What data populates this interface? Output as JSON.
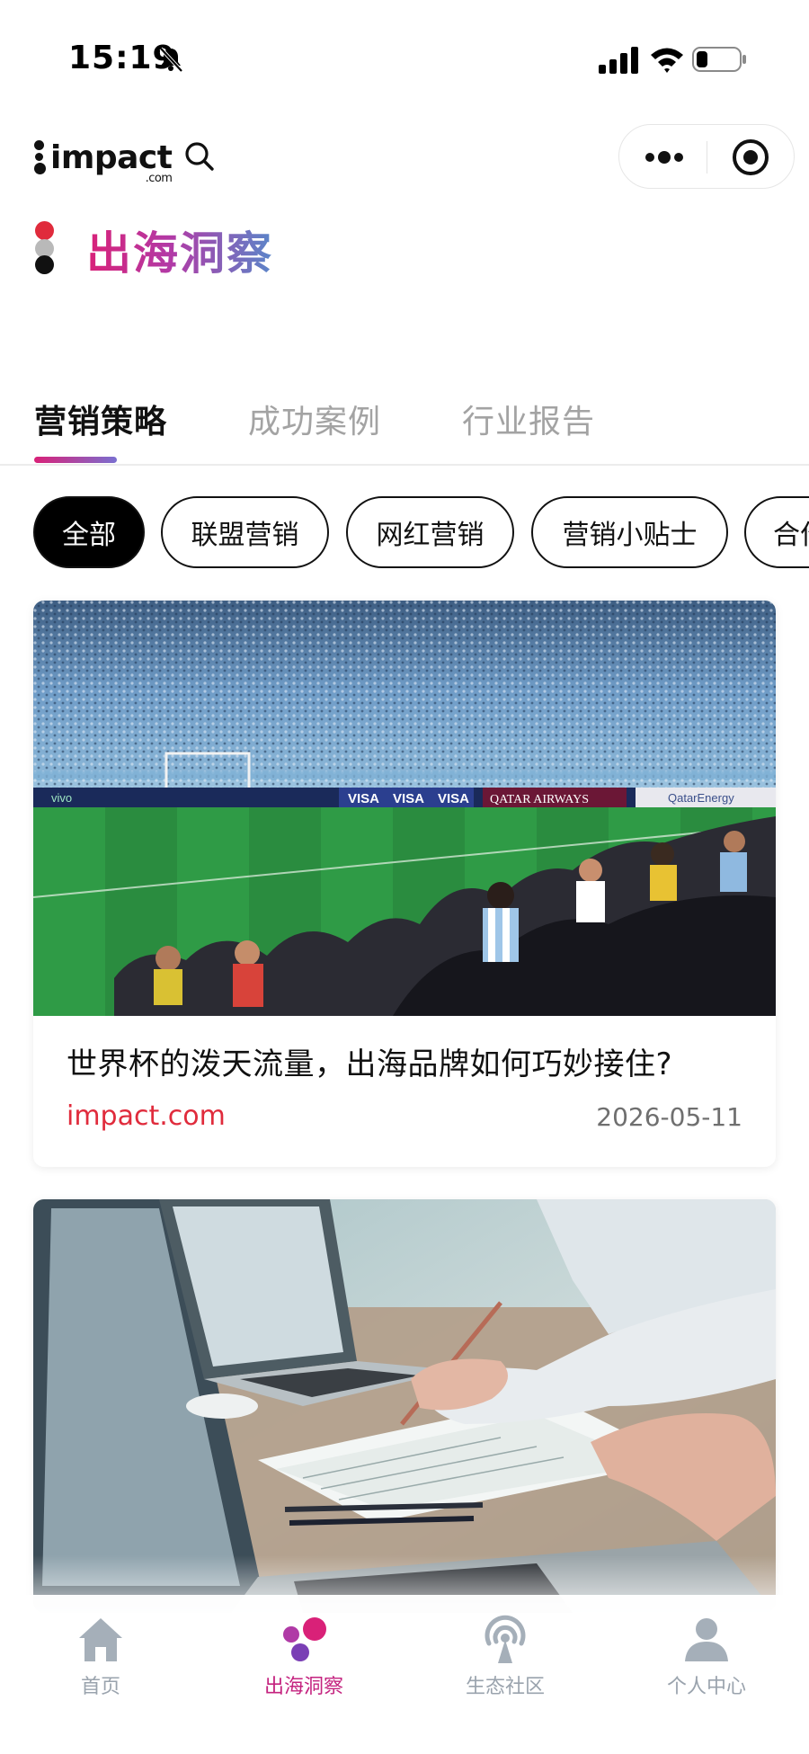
{
  "status_bar": {
    "time": "15:19"
  },
  "header": {
    "logo_text": "impact",
    "logo_sub": ".com"
  },
  "page": {
    "title": "出海洞察"
  },
  "tabs": [
    {
      "label": "营销策略",
      "active": true
    },
    {
      "label": "成功案例",
      "active": false
    },
    {
      "label": "行业报告",
      "active": false
    }
  ],
  "filters": [
    {
      "label": "全部",
      "active": true
    },
    {
      "label": "联盟营销",
      "active": false
    },
    {
      "label": "网红营销",
      "active": false
    },
    {
      "label": "营销小贴士",
      "active": false
    },
    {
      "label": "合作",
      "active": false
    }
  ],
  "articles": [
    {
      "title": "世界杯的泼天流量，出海品牌如何巧妙接住?",
      "source": "impact.com",
      "date": "2026-05-11",
      "image": "stadium-photo",
      "billboards": [
        "vivo",
        "VISA",
        "VISA",
        "VISA",
        "QATAR AIRWAYS",
        "QatarEnergy"
      ]
    },
    {
      "image": "laptop-desk-photo"
    }
  ],
  "bottom_nav": [
    {
      "label": "首页",
      "icon": "home-icon",
      "active": false
    },
    {
      "label": "出海洞察",
      "icon": "insight-dots-icon",
      "active": true
    },
    {
      "label": "生态社区",
      "icon": "broadcast-icon",
      "active": false
    },
    {
      "label": "个人中心",
      "icon": "person-icon",
      "active": false
    }
  ],
  "colors": {
    "accent": "#c4237f",
    "title_gradient_start": "#d92178",
    "title_gradient_end": "#5a86c9",
    "source_red": "#e02b3c",
    "inactive_gray": "#9aa3ad"
  }
}
